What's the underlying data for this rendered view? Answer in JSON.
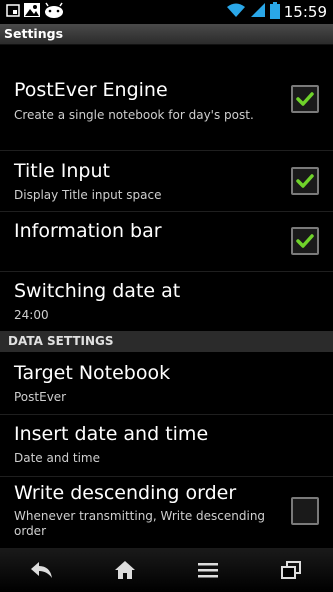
{
  "status_bar": {
    "time": "15:59",
    "icons": [
      "sim-card-icon",
      "image-notification-icon",
      "android-icon",
      "wifi-icon",
      "signal-icon",
      "battery-icon"
    ]
  },
  "title_bar": {
    "title": "Settings"
  },
  "items": [
    {
      "title": "PostEver Engine",
      "summary": "Create a single notebook for day's post.",
      "checked": true
    },
    {
      "title": "Title Input",
      "summary": "Display Title input space",
      "checked": true
    },
    {
      "title": "Information bar",
      "checked": true
    },
    {
      "title": "Switching date at",
      "summary": "24:00"
    }
  ],
  "section": {
    "label": "DATA SETTINGS"
  },
  "data_items": [
    {
      "title": "Target Notebook",
      "summary": "PostEver"
    },
    {
      "title": "Insert date and time",
      "summary": "Date and time"
    },
    {
      "title": "Write descending order",
      "summary": "Whenever transmitting, Write descending order",
      "checked": false
    }
  ],
  "nav": [
    "back-icon",
    "home-icon",
    "menu-icon",
    "recent-apps-icon"
  ],
  "colors": {
    "check": "#6fd32a",
    "section_bg": "#2b2b2b"
  }
}
